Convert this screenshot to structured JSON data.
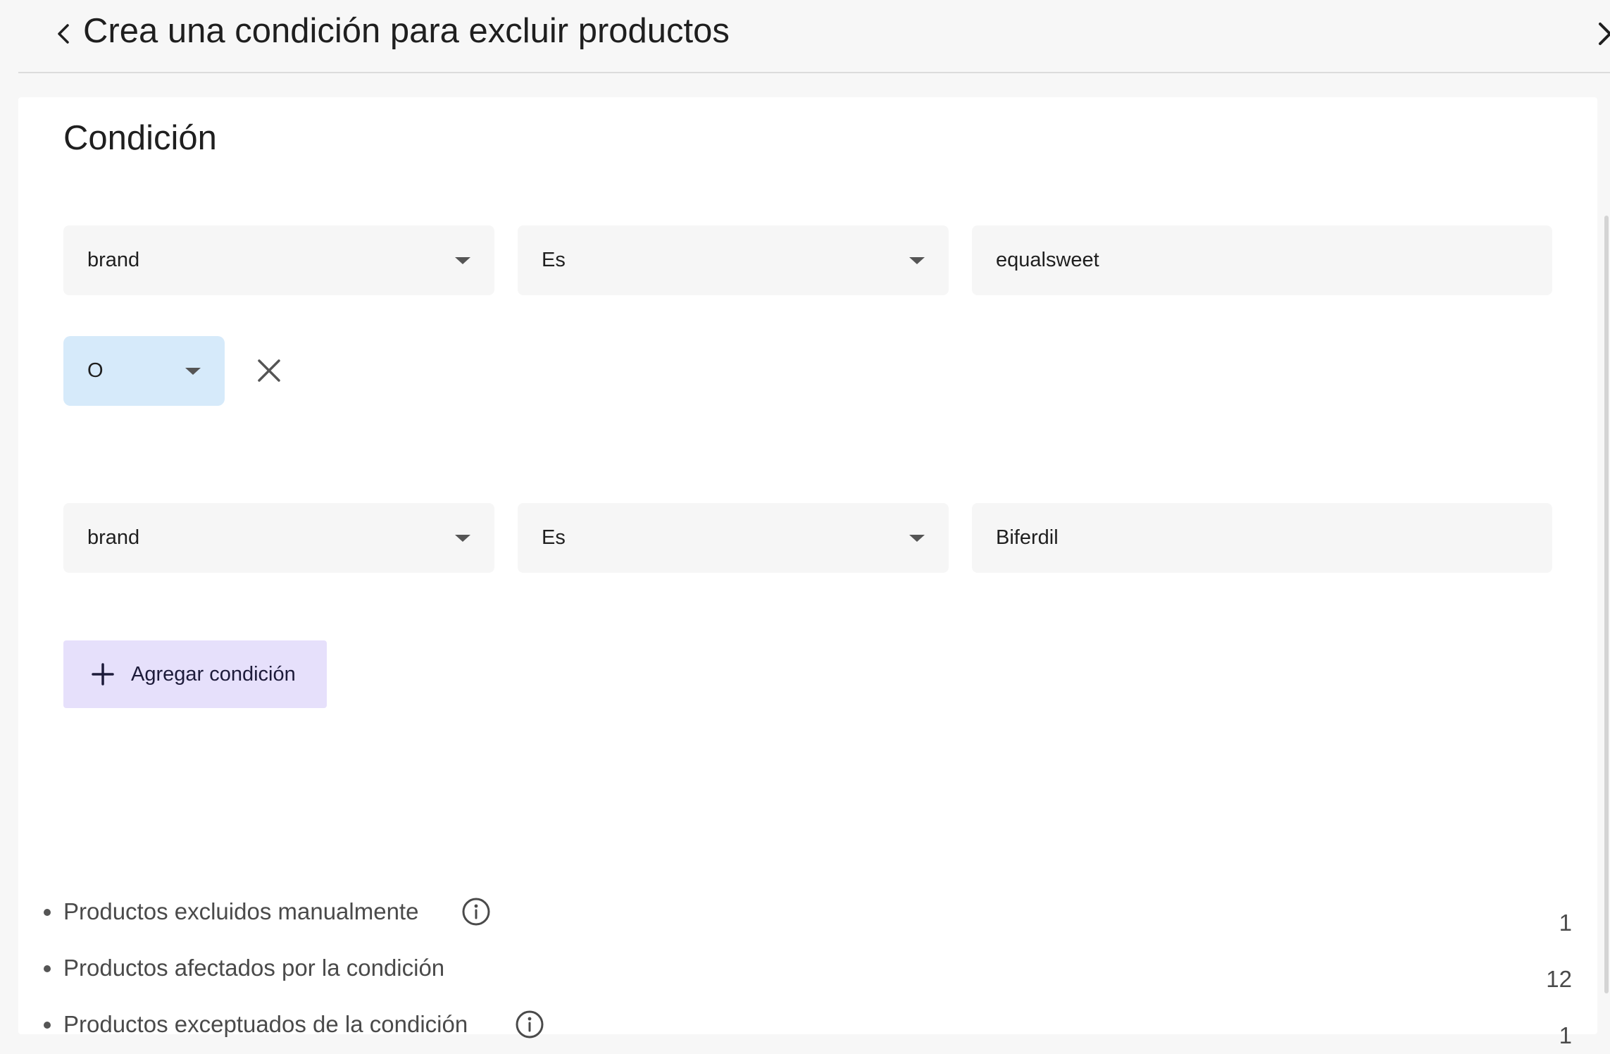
{
  "header": {
    "title": "Crea una condición para excluir productos",
    "back_icon": "chevron-left-icon",
    "close_icon": "close-icon"
  },
  "section": {
    "title": "Condición"
  },
  "conditions": [
    {
      "attribute": "brand",
      "operator": "Es",
      "value": "equalsweet"
    },
    {
      "attribute": "brand",
      "operator": "Es",
      "value": "Biferdil"
    }
  ],
  "logic": {
    "selected": "O",
    "remove_icon": "close-icon"
  },
  "add_condition": {
    "label": "Agregar condición",
    "icon": "plus-icon"
  },
  "stats": [
    {
      "label": "Productos excluidos manualmente",
      "value": "1",
      "has_info": true
    },
    {
      "label": "Productos afectados por la condición",
      "value": "12",
      "has_info": false
    },
    {
      "label": "Productos exceptuados de la condición",
      "value": "1",
      "has_info": true
    }
  ],
  "colors": {
    "logic_bg": "#d6eafa",
    "add_button_bg": "#e6e0fb",
    "field_bg": "#f6f6f6"
  }
}
